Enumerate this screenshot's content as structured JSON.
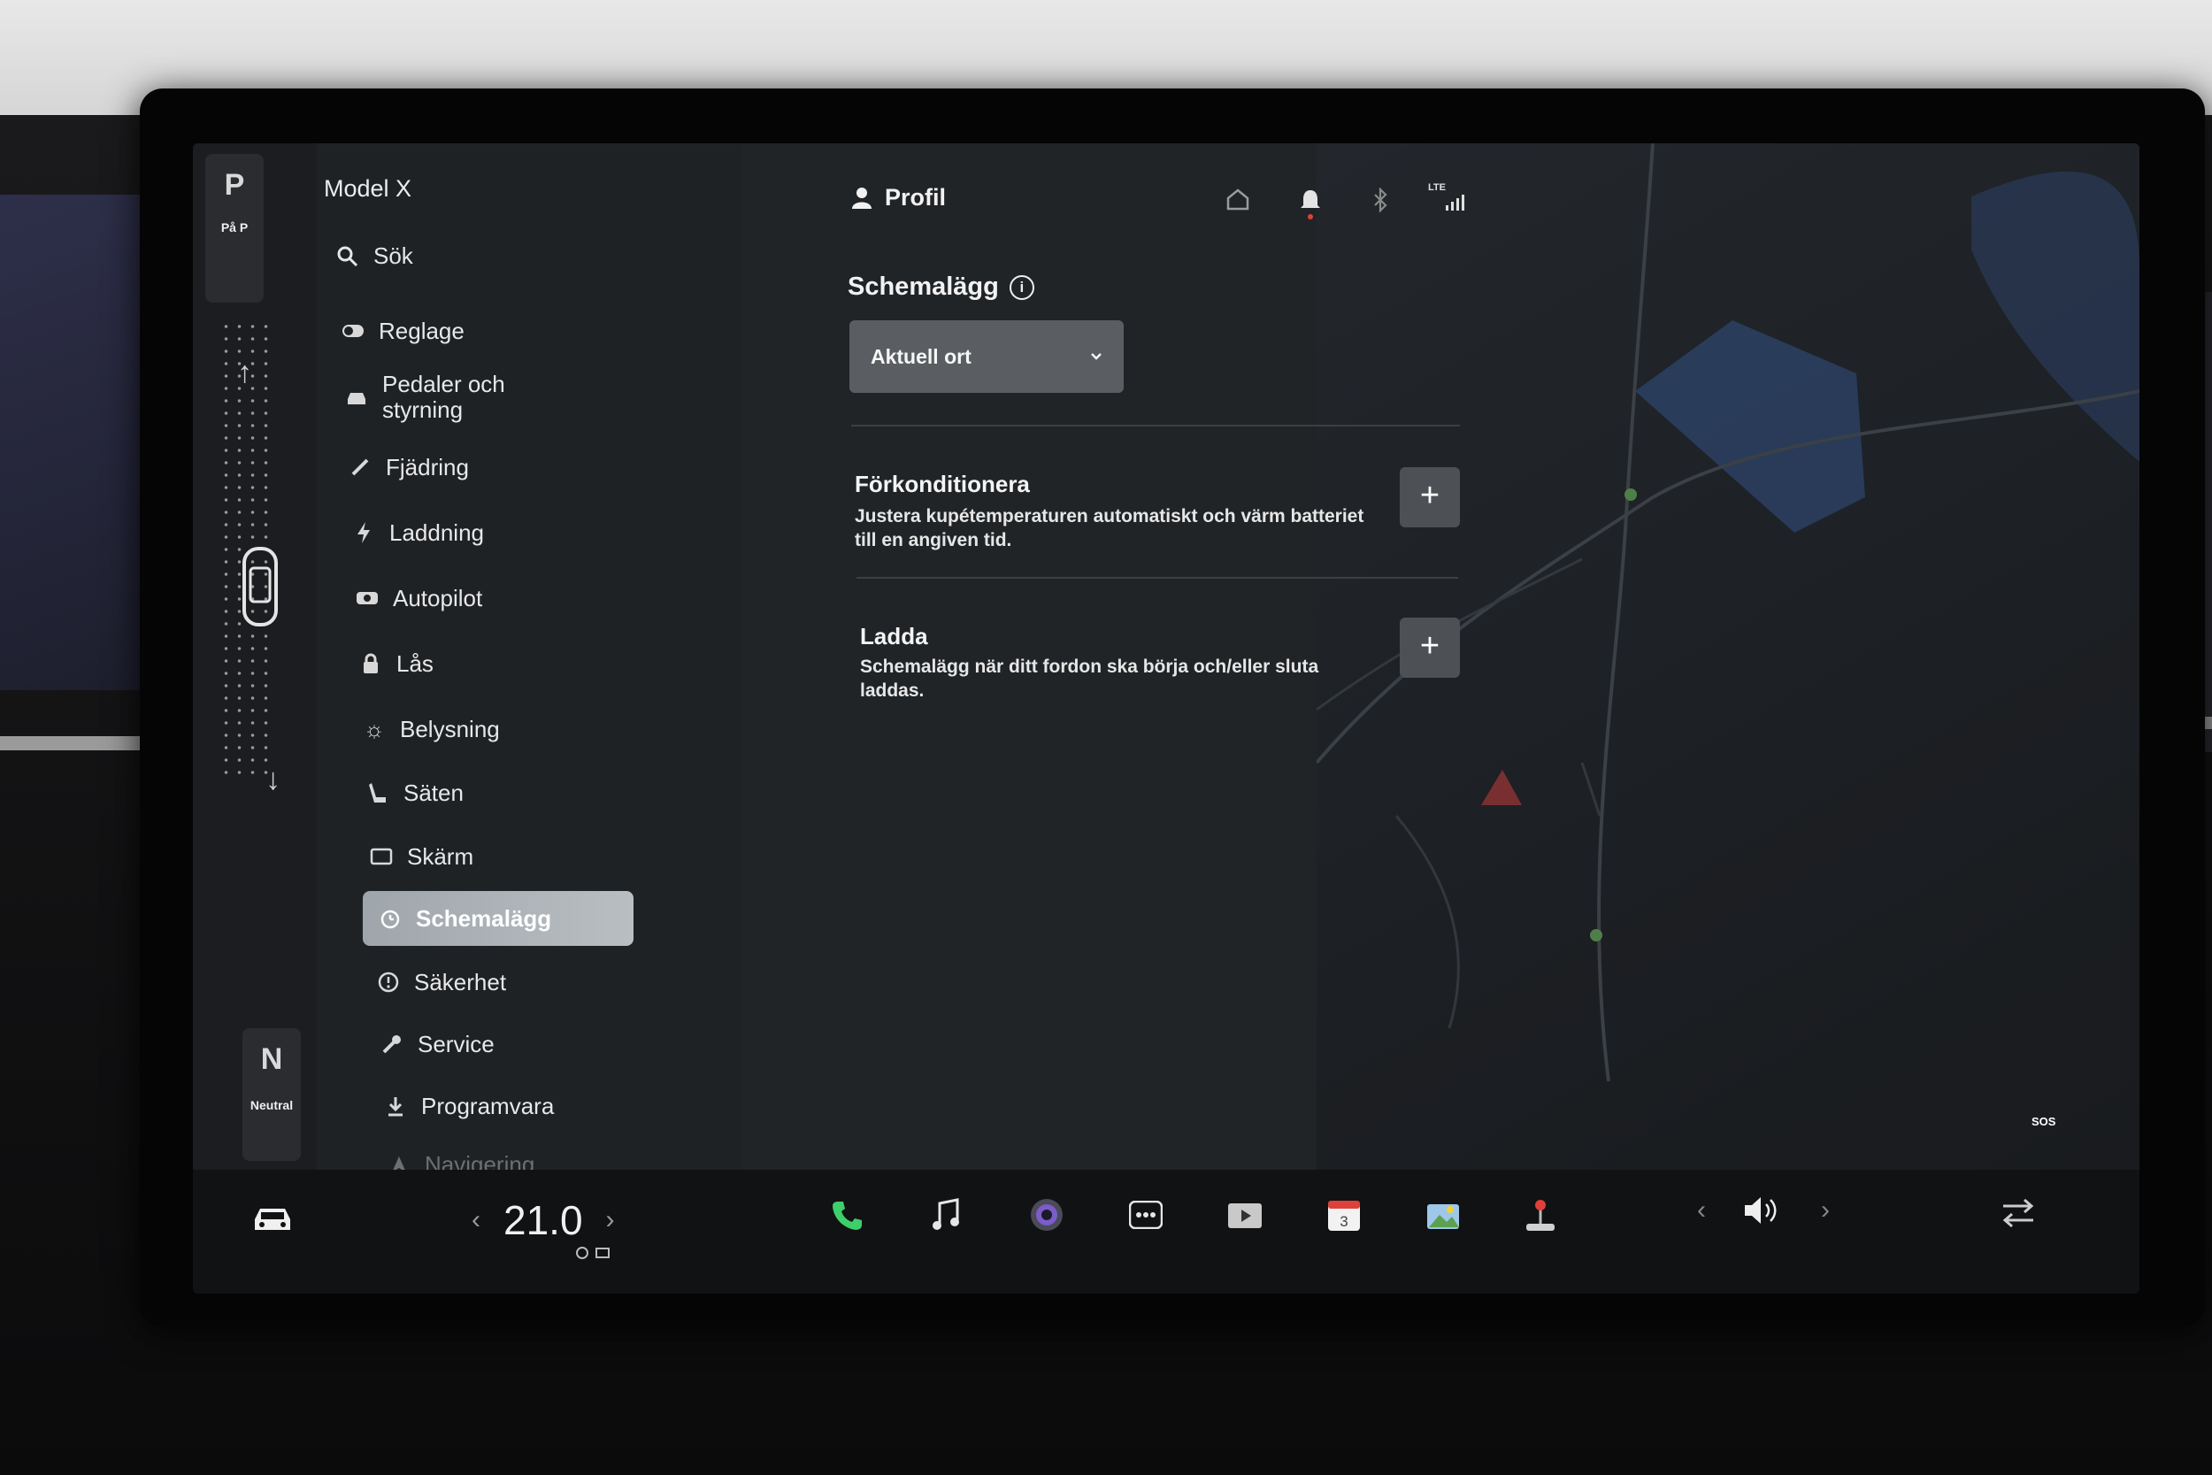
{
  "gear": {
    "park_letter": "P",
    "park_sub": "På P",
    "neutral_letter": "N",
    "neutral_sub": "Neutral"
  },
  "sidebar": {
    "model": "Model X",
    "search_label": "Sök",
    "items": [
      {
        "label": "Reglage",
        "icon": "toggle-icon"
      },
      {
        "label": "Pedaler och styrning",
        "icon": "car-icon"
      },
      {
        "label": "Fjädring",
        "icon": "suspension-icon"
      },
      {
        "label": "Laddning",
        "icon": "bolt-icon"
      },
      {
        "label": "Autopilot",
        "icon": "steering-wheel-icon"
      },
      {
        "label": "Lås",
        "icon": "lock-icon"
      },
      {
        "label": "Belysning",
        "icon": "sun-icon"
      },
      {
        "label": "Säten",
        "icon": "seat-icon"
      },
      {
        "label": "Skärm",
        "icon": "display-icon"
      },
      {
        "label": "Schemalägg",
        "icon": "alarm-clock-icon",
        "active": true
      },
      {
        "label": "Säkerhet",
        "icon": "alert-circle-icon"
      },
      {
        "label": "Service",
        "icon": "wrench-icon"
      },
      {
        "label": "Programvara",
        "icon": "download-icon"
      },
      {
        "label": "Navigering",
        "icon": "navigation-icon"
      }
    ]
  },
  "header": {
    "profile_label": "Profil",
    "status_icons": [
      "home-icon",
      "bell-icon",
      "bluetooth-icon",
      "lte-signal-icon"
    ],
    "lte_label": "LTE"
  },
  "schedule": {
    "title": "Schemalägg",
    "location_dropdown": "Aktuell ort",
    "rows": [
      {
        "title": "Förkonditionera",
        "description": "Justera kupétemperaturen automatiskt och värm batteriet till en angiven tid."
      },
      {
        "title": "Ladda",
        "description": "Schemalägg när ditt fordon ska börja och/eller sluta laddas."
      }
    ]
  },
  "map": {
    "sos_label": "SOS"
  },
  "bottom_bar": {
    "temperature": "21.0",
    "dock_icons": [
      "phone-icon",
      "music-icon",
      "camera-icon",
      "more-icon",
      "video-icon",
      "calendar-icon",
      "photo-gallery-icon",
      "joystick-icon"
    ],
    "calendar_day": "3",
    "colors": {
      "phone": "#3ecf6a",
      "accent_red": "#e0403a"
    }
  }
}
